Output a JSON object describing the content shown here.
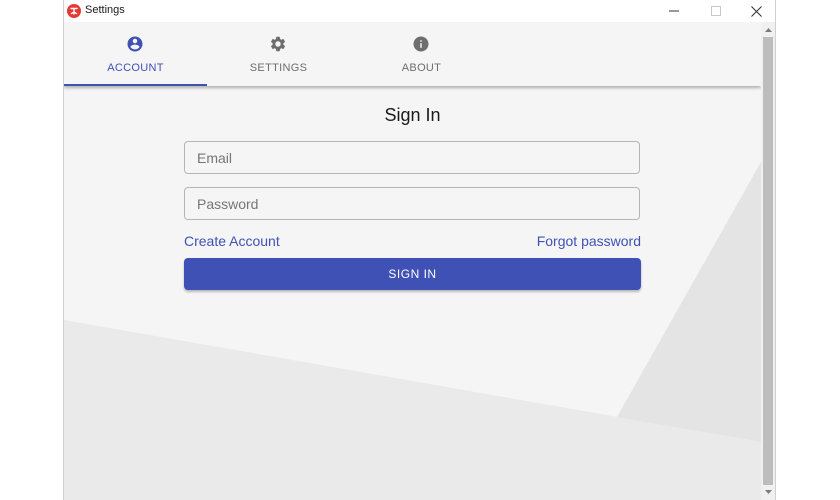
{
  "window": {
    "title": "Settings"
  },
  "tabs": [
    {
      "label": "ACCOUNT",
      "icon": "account-circle-icon",
      "active": true
    },
    {
      "label": "SETTINGS",
      "icon": "gear-icon",
      "active": false
    },
    {
      "label": "ABOUT",
      "icon": "info-icon",
      "active": false
    }
  ],
  "form": {
    "heading": "Sign In",
    "email_placeholder": "Email",
    "email_value": "",
    "password_placeholder": "Password",
    "password_value": "",
    "create_account_label": "Create Account",
    "forgot_password_label": "Forgot password",
    "signin_label": "SIGN IN"
  },
  "colors": {
    "accent": "#3f51b5",
    "background": "#f5f5f5",
    "app_icon": "#e53935"
  }
}
